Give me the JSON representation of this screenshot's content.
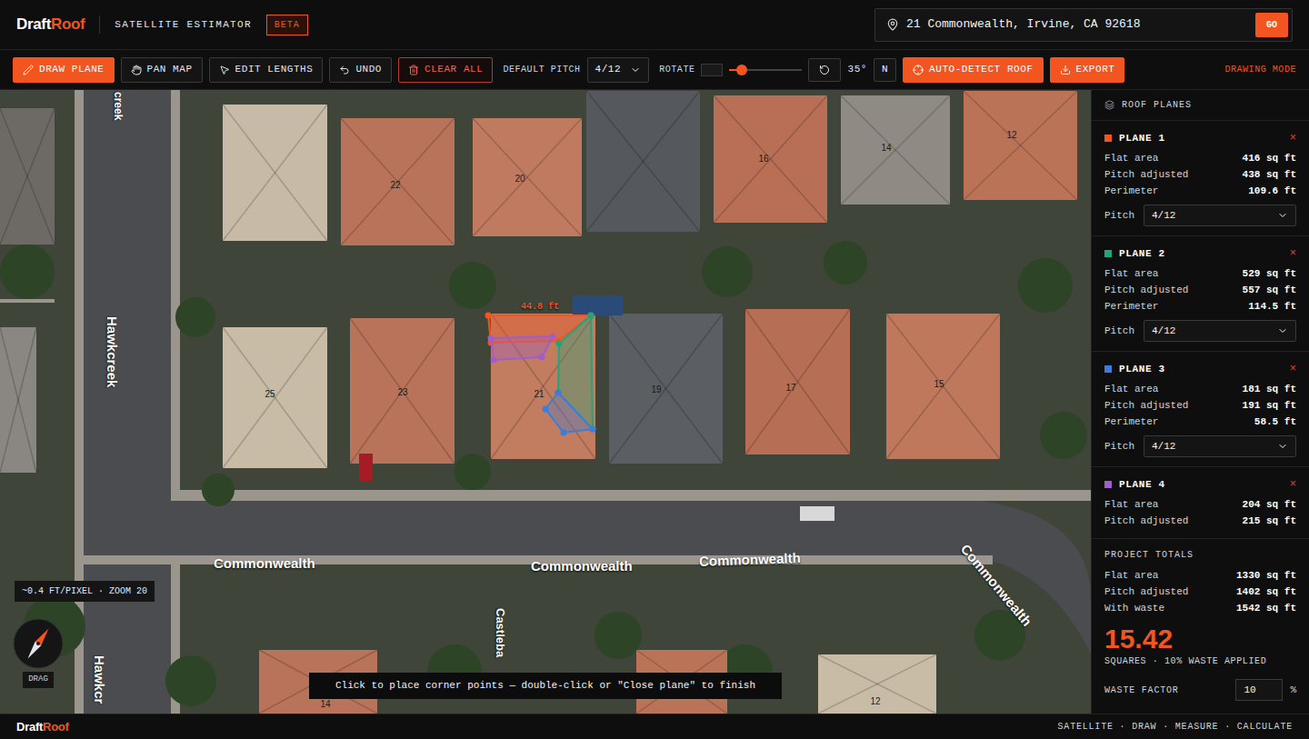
{
  "header": {
    "logo": {
      "first": "Draft",
      "second": "Roof"
    },
    "subtitle": "SATELLITE ESTIMATOR",
    "badge": "BETA",
    "address": "21 Commonwealth, Irvine, CA 92618",
    "go": "GO"
  },
  "toolbar": {
    "tools": [
      {
        "label": "DRAW PLANE",
        "kind": "tool",
        "selected": true
      },
      {
        "label": "PAN MAP",
        "kind": "tool",
        "selected": false
      },
      {
        "label": "EDIT LENGTHS",
        "kind": "tool",
        "selected": false
      },
      {
        "label": "UNDO",
        "kind": "tool",
        "selected": false
      },
      {
        "label": "CLEAR ALL",
        "kind": "danger",
        "selected": false
      }
    ],
    "pitch": {
      "label": "DEFAULT PITCH",
      "value": "4/12"
    },
    "rotate": {
      "label": "ROTATE",
      "level": 0.17,
      "reading": "35°",
      "north": "N"
    },
    "actions": [
      "AUTO-DETECT ROOF",
      "EXPORT"
    ],
    "mode": "DRAWING MODE"
  },
  "map": {
    "streets": [
      "creek",
      "Hawkcreek",
      "Hawkcr",
      "Commonwealth",
      "Commonwealth",
      "Commonwealth",
      "Commonwealth",
      "Castleba"
    ],
    "house_numbers": [
      "22",
      "20",
      "16",
      "14",
      "12",
      "25",
      "23",
      "21",
      "19",
      "17",
      "15",
      "14",
      "12"
    ],
    "measure_label": "44.8 ft",
    "scale": "~0.4 FT/PIXEL · ZOOM 20",
    "compass_label": "DRAG",
    "hint": "Click to place corner points — double-click or \"Close plane\" to finish"
  },
  "sidebar": {
    "title": "ROOF PLANES",
    "planes": [
      {
        "name": "PLANE 1",
        "color": "#f2551f",
        "close": "×",
        "stats": [
          {
            "label": "Flat area",
            "value": "416 sq ft"
          },
          {
            "label": "Pitch adjusted",
            "value": "438 sq ft"
          },
          {
            "label": "Perimeter",
            "value": "109.6 ft"
          }
        ],
        "pitch": {
          "label": "Pitch",
          "value": "4/12"
        }
      },
      {
        "name": "PLANE 2",
        "color": "#1fa67a",
        "close": "×",
        "stats": [
          {
            "label": "Flat area",
            "value": "529 sq ft"
          },
          {
            "label": "Pitch adjusted",
            "value": "557 sq ft"
          },
          {
            "label": "Perimeter",
            "value": "114.5 ft"
          }
        ],
        "pitch": {
          "label": "Pitch",
          "value": "4/12"
        }
      },
      {
        "name": "PLANE 3",
        "color": "#3b7dd8",
        "close": "×",
        "stats": [
          {
            "label": "Flat area",
            "value": "181 sq ft"
          },
          {
            "label": "Pitch adjusted",
            "value": "191 sq ft"
          },
          {
            "label": "Perimeter",
            "value": "58.5 ft"
          }
        ],
        "pitch": {
          "label": "Pitch",
          "value": "4/12"
        }
      },
      {
        "name": "PLANE 4",
        "color": "#a05fc8",
        "close": "×",
        "stats": [
          {
            "label": "Flat area",
            "value": "204 sq ft"
          },
          {
            "label": "Pitch adjusted",
            "value": "215 sq ft"
          }
        ],
        "pitch": null
      }
    ],
    "totals": {
      "title": "PROJECT TOTALS",
      "rows": [
        {
          "label": "Flat area",
          "value": "1330 sq ft"
        },
        {
          "label": "Pitch adjusted",
          "value": "1402 sq ft"
        },
        {
          "label": "With waste",
          "value": "1542 sq ft"
        }
      ],
      "squares": "15.42",
      "caption": "SQUARES · 10% WASTE APPLIED",
      "waste_label": "WASTE FACTOR",
      "waste_value": "10",
      "waste_unit": "%"
    }
  },
  "footer": {
    "logo": {
      "first": "Draft",
      "second": "Roof"
    },
    "tagline": "SATELLITE · DRAW · MEASURE · CALCULATE"
  }
}
